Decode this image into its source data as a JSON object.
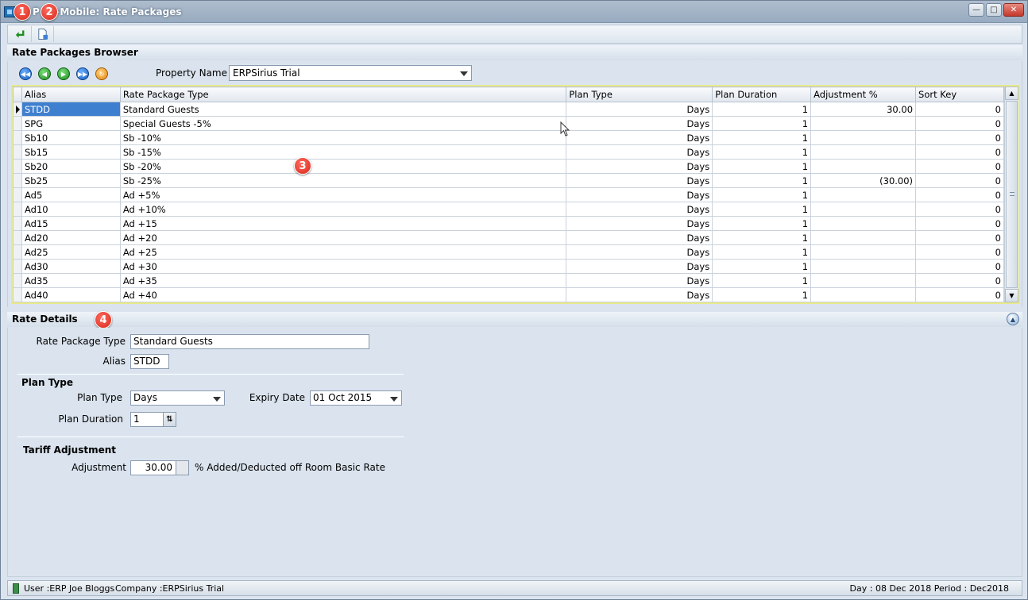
{
  "window": {
    "title": "ERPSirius +Mobile: Rate Packages",
    "title_visible": "P    s +Mobile: Rate Packages"
  },
  "callouts": [
    "1",
    "2",
    "3",
    "4"
  ],
  "toolbar": {
    "buttons": [
      {
        "name": "back",
        "icon": "green-return-arrow-icon"
      },
      {
        "name": "new-document",
        "icon": "document-icon"
      }
    ]
  },
  "browser": {
    "title": "Rate Packages Browser",
    "property_label": "Property Name",
    "property_value": "ERPSirius Trial",
    "columns": [
      "Alias",
      "Rate Package Type",
      "Plan Type",
      "Plan Duration",
      "Adjustment %",
      "Sort Key"
    ],
    "rows": [
      {
        "alias": "STDD",
        "type": "Standard Guests",
        "plan": "Days",
        "duration": "1",
        "adjust": "30.00",
        "sort": "0"
      },
      {
        "alias": "SPG",
        "type": "Special Guests -5%",
        "plan": "Days",
        "duration": "1",
        "adjust": "",
        "sort": "0"
      },
      {
        "alias": "Sb10",
        "type": "Sb -10%",
        "plan": "Days",
        "duration": "1",
        "adjust": "",
        "sort": "0"
      },
      {
        "alias": "Sb15",
        "type": "Sb -15%",
        "plan": "Days",
        "duration": "1",
        "adjust": "",
        "sort": "0"
      },
      {
        "alias": "Sb20",
        "type": "Sb -20%",
        "plan": "Days",
        "duration": "1",
        "adjust": "",
        "sort": "0"
      },
      {
        "alias": "Sb25",
        "type": "Sb -25%",
        "plan": "Days",
        "duration": "1",
        "adjust": "(30.00)",
        "sort": "0"
      },
      {
        "alias": "Ad5",
        "type": "Ad +5%",
        "plan": "Days",
        "duration": "1",
        "adjust": "",
        "sort": "0"
      },
      {
        "alias": "Ad10",
        "type": "Ad +10%",
        "plan": "Days",
        "duration": "1",
        "adjust": "",
        "sort": "0"
      },
      {
        "alias": "Ad15",
        "type": "Ad +15",
        "plan": "Days",
        "duration": "1",
        "adjust": "",
        "sort": "0"
      },
      {
        "alias": "Ad20",
        "type": "Ad +20",
        "plan": "Days",
        "duration": "1",
        "adjust": "",
        "sort": "0"
      },
      {
        "alias": "Ad25",
        "type": "Ad +25",
        "plan": "Days",
        "duration": "1",
        "adjust": "",
        "sort": "0"
      },
      {
        "alias": "Ad30",
        "type": "Ad +30",
        "plan": "Days",
        "duration": "1",
        "adjust": "",
        "sort": "0"
      },
      {
        "alias": "Ad35",
        "type": "Ad +35",
        "plan": "Days",
        "duration": "1",
        "adjust": "",
        "sort": "0"
      },
      {
        "alias": "Ad40",
        "type": "Ad +40",
        "plan": "Days",
        "duration": "1",
        "adjust": "",
        "sort": "0"
      }
    ]
  },
  "details": {
    "title": "Rate Details",
    "rate_package_type_label": "Rate Package Type",
    "rate_package_type_value": "Standard Guests",
    "alias_label": "Alias",
    "alias_value": "STDD",
    "plan_type_group": "Plan Type",
    "plan_type_label": "Plan Type",
    "plan_type_value": "Days",
    "expiry_label": "Expiry Date",
    "expiry_value": "01 Oct 2015",
    "plan_duration_label": "Plan Duration",
    "plan_duration_value": "1",
    "tariff_group": "Tariff Adjustment",
    "adjustment_label": "Adjustment",
    "adjustment_value": "30.00",
    "adjustment_suffix": "% Added/Deducted off Room Basic Rate"
  },
  "status": {
    "user": "User :ERP Joe Bloggs",
    "company": "Company :ERPSirius Trial",
    "right": "Day : 08 Dec 2018  Period : Dec2018"
  }
}
